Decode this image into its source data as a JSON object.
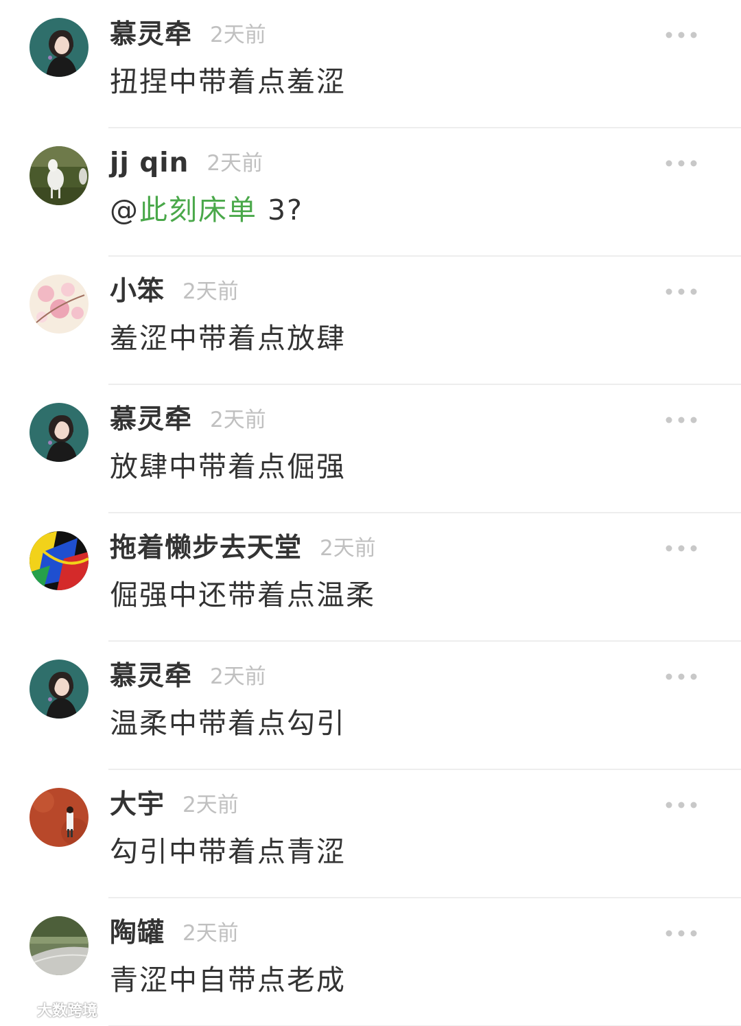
{
  "comments": [
    {
      "name": "慕灵牵",
      "time": "2天前",
      "text": "扭捏中带着点羞涩",
      "avatar": "girl-avatar"
    },
    {
      "name": "jj qin",
      "time": "2天前",
      "mention": "@",
      "mention_name": "此刻床单",
      "text_after": " 3?",
      "avatar": "lamb-avatar"
    },
    {
      "name": "小笨",
      "time": "2天前",
      "text": "羞涩中带着点放肆",
      "avatar": "blossom-avatar"
    },
    {
      "name": "慕灵牵",
      "time": "2天前",
      "text": "放肆中带着点倔强",
      "avatar": "girl-avatar"
    },
    {
      "name": "拖着懒步去天堂",
      "time": "2天前",
      "text": "倔强中还带着点温柔",
      "avatar": "abstract-avatar"
    },
    {
      "name": "慕灵牵",
      "time": "2天前",
      "text": "温柔中带着点勾引",
      "avatar": "girl-avatar"
    },
    {
      "name": "大宇",
      "time": "2天前",
      "text": "勾引中带着点青涩",
      "avatar": "red-wall-avatar"
    },
    {
      "name": "陶罐",
      "time": "2天前",
      "text": "青涩中自带点老成",
      "avatar": "road-avatar"
    }
  ],
  "colors": {
    "name": "#333333",
    "time": "#c0c0c0",
    "mention": "#4aa84a",
    "divider": "#ededed"
  },
  "watermark": {
    "text": "大数跨境"
  }
}
